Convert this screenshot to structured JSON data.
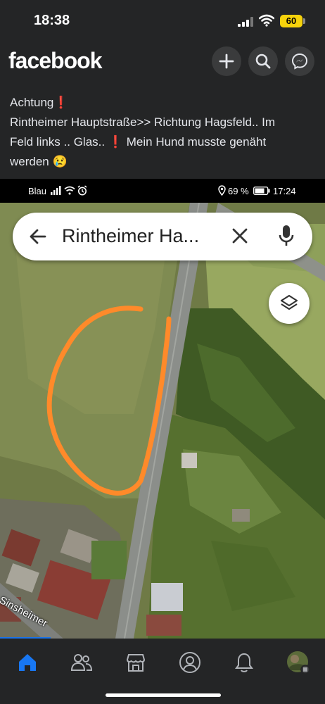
{
  "status_bar": {
    "time": "18:38",
    "battery": "60"
  },
  "header": {
    "logo": "facebook",
    "actions": [
      {
        "name": "create-button",
        "icon": "plus-icon"
      },
      {
        "name": "search-button",
        "icon": "search-icon"
      },
      {
        "name": "messenger-button",
        "icon": "messenger-icon"
      }
    ]
  },
  "post": {
    "line1": "Achtung",
    "line2": "Rintheimer Hauptstraße>> Richtung Hagsfeld.. Im",
    "line3a": "Feld links .. Glas..",
    "line3b": "Mein Hund  musste genäht",
    "line4": "werden",
    "emoji_red": "❗",
    "emoji_cry": "😢"
  },
  "screenshot": {
    "status": {
      "carrier": "Blau",
      "battery_percent": "69 %",
      "time": "17:24"
    },
    "search": {
      "query": "Rintheimer Ha..."
    },
    "street_label": "Sinsheimer"
  },
  "tabs": [
    {
      "name": "home",
      "icon": "home-icon",
      "active": true
    },
    {
      "name": "friends",
      "icon": "friends-icon"
    },
    {
      "name": "marketplace",
      "icon": "marketplace-icon"
    },
    {
      "name": "profile",
      "icon": "profile-icon"
    },
    {
      "name": "notifications",
      "icon": "bell-icon"
    },
    {
      "name": "menu",
      "icon": "avatar-menu-icon"
    }
  ],
  "colors": {
    "accent": "#1877f2",
    "annotation": "#ff8a2a",
    "battery": "#f7d30b"
  }
}
